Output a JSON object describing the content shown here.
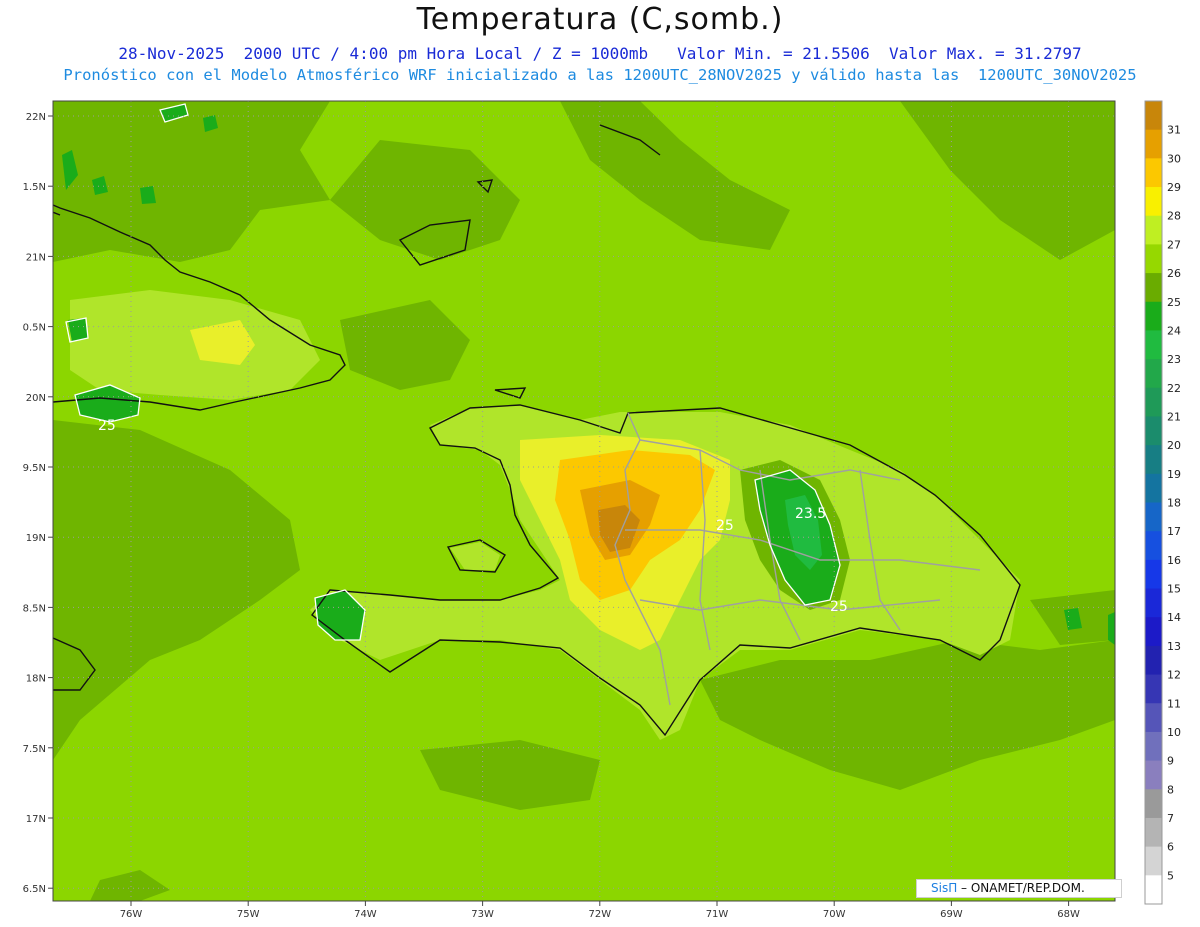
{
  "header": {
    "title": "Temperatura (C,somb.)",
    "line1": "28-Nov-2025  2000 UTC / 4:00 pm Hora Local / Z = 1000mb   Valor Min. = 21.5506  Valor Max. = 31.2797",
    "line2": "Pronóstico con el Modelo Atmosférico WRF inicializado a las 1200UTC_28NOV2025 y válido hasta las  1200UTC_30NOV2025"
  },
  "axes": {
    "lat_labels": [
      "22N",
      "1.5N",
      "21N",
      "0.5N",
      "20N",
      "9.5N",
      "19N",
      "8.5N",
      "18N",
      "7.5N",
      "17N",
      "6.5N"
    ],
    "lon_labels": [
      "76W",
      "75W",
      "74W",
      "73W",
      "72W",
      "71W",
      "70W",
      "69W",
      "68W"
    ]
  },
  "colorbar": {
    "labels": [
      "31",
      "30",
      "29",
      "28",
      "27",
      "26",
      "25",
      "24",
      "23",
      "22",
      "21",
      "20",
      "19",
      "18",
      "17",
      "16",
      "15",
      "14",
      "13",
      "12",
      "11",
      "10",
      "9",
      "8",
      "7",
      "6",
      "5"
    ],
    "colors": [
      "#c8860a",
      "#e6a000",
      "#fcc800",
      "#f9f000",
      "#bfef22",
      "#96d800",
      "#6aac00",
      "#1aac1a",
      "#20bb40",
      "#22a84a",
      "#1f9a58",
      "#1b8c6c",
      "#177e84",
      "#1474a0",
      "#1666c8",
      "#1650e0",
      "#1638e8",
      "#1a28d8",
      "#1c1ac8",
      "#2222b0",
      "#3636b4",
      "#5555b8",
      "#7070bc",
      "#8a7fbe",
      "#9a9a9a",
      "#b4b4b4",
      "#d4d4d4",
      "#ffffff"
    ]
  },
  "contour_labels": [
    "25",
    "25",
    "23.5",
    "25"
  ],
  "credit": {
    "brand": "SisΠ",
    "text": " – ONAMET/REP.DOM."
  }
}
